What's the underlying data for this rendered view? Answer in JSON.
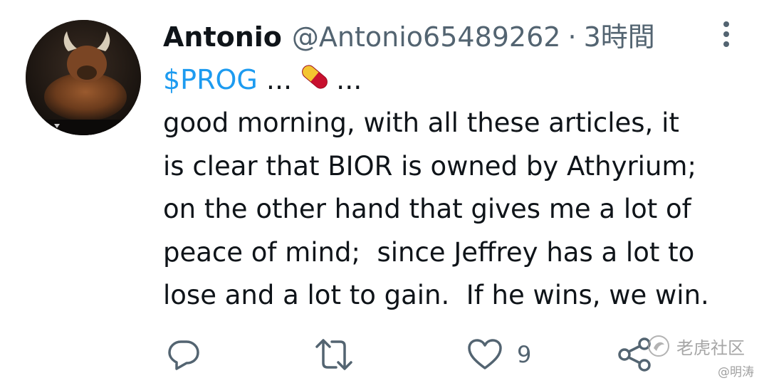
{
  "author": {
    "display_name": "Antonio",
    "handle": "@Antonio65489262",
    "separator": "·",
    "time": "3時間"
  },
  "tweet": {
    "cashtag": "$PROG",
    "ellipsis_before": "...",
    "emoji_icon": "pill-icon",
    "ellipsis_after": "...",
    "lines": [
      "good morning, with all these articles, it",
      "is clear that BIOR is owned by Athyrium;",
      "on the other hand that gives me a lot of",
      "peace of mind;  since Jeffrey has a lot to",
      "lose and a lot to gain.  If he wins, we win."
    ]
  },
  "actions": {
    "reply_icon": "reply-icon",
    "retweet_icon": "retweet-icon",
    "like_icon": "heart-icon",
    "like_count": "9",
    "share_icon": "share-icon"
  },
  "watermark": {
    "text": "老虎社区",
    "sub": "@明涛"
  },
  "colors": {
    "text": "#0f1419",
    "secondary": "#536471",
    "link": "#1d9bf0"
  }
}
